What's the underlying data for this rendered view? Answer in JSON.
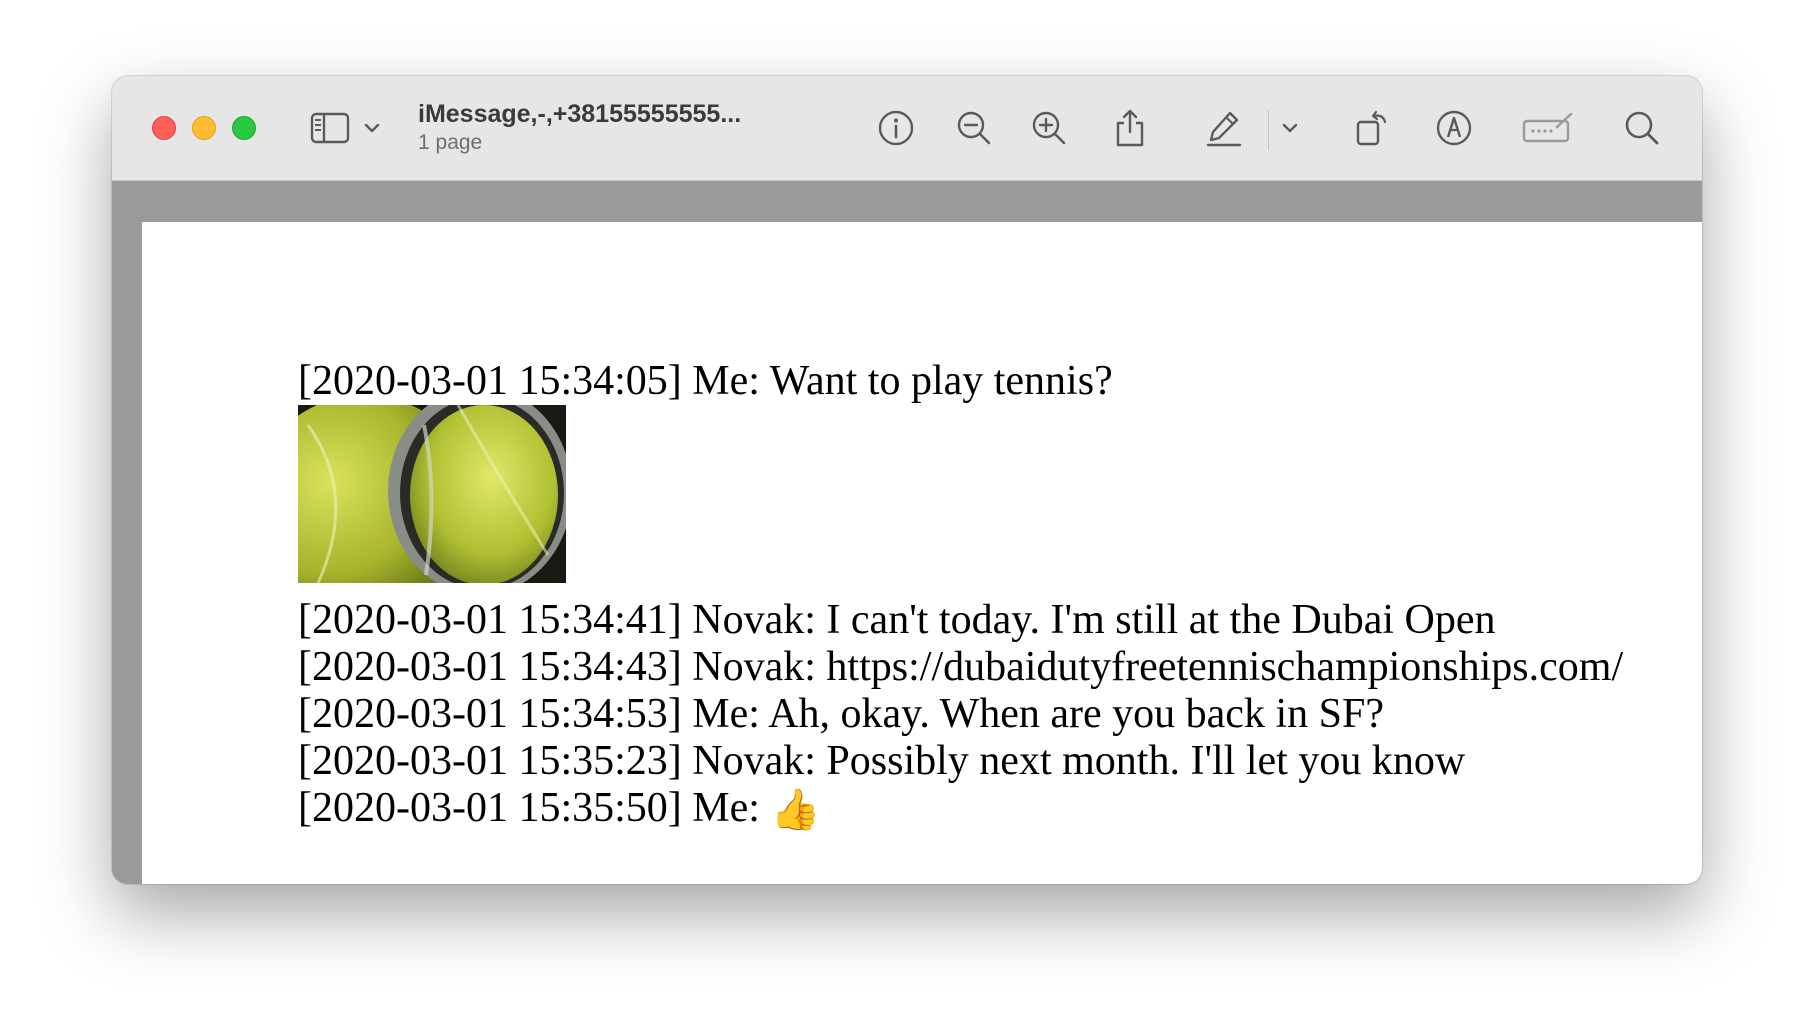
{
  "window": {
    "title": "iMessage,-,+38155555555...",
    "subtitle": "1 page"
  },
  "toolbar": {
    "icons": [
      "sidebar-icon",
      "chevron-down-icon",
      "info-icon",
      "zoom-out-icon",
      "zoom-in-icon",
      "share-icon",
      "highlight-pen-icon",
      "chevron-down-icon",
      "rotate-icon",
      "markup-icon",
      "form-fill-icon",
      "search-icon"
    ]
  },
  "messages": [
    {
      "text": "[2020-03-01 15:34:05] Me: Want to play tennis?"
    },
    {
      "text": "[2020-03-01 15:34:41] Novak: I can't today. I'm still at the Dubai Open"
    },
    {
      "text": "[2020-03-01 15:34:43] Novak: https://dubaidutyfreetennischampionships.com/"
    },
    {
      "text": "[2020-03-01 15:34:53] Me: Ah, okay. When are you back in SF?"
    },
    {
      "text": "[2020-03-01 15:35:23] Novak: Possibly next month. I'll let you know"
    },
    {
      "text": "[2020-03-01 15:35:50] Me: ",
      "emoji": "👍"
    }
  ],
  "attachment": {
    "icon": "tennis-balls-image"
  },
  "colors": {
    "toolbar_bg": "#e6e6e6",
    "canvas_bg": "#9a9a9a",
    "page_bg": "#ffffff"
  }
}
